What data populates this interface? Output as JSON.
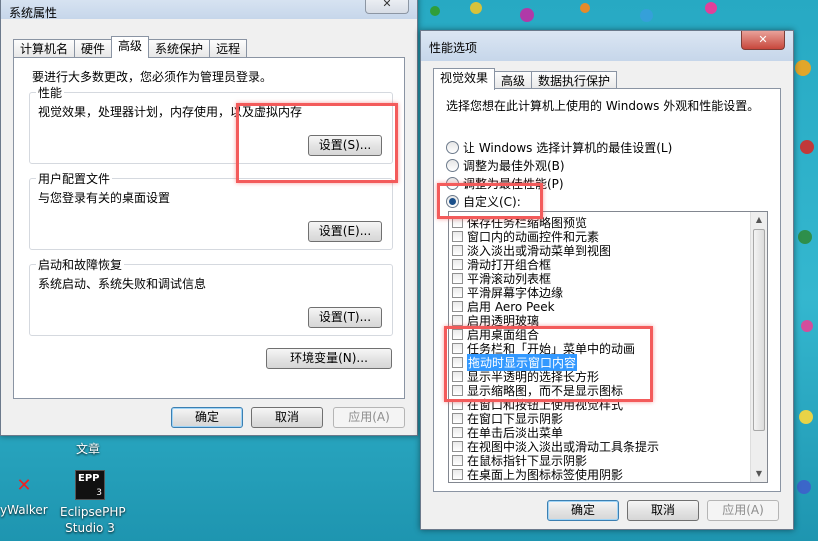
{
  "desktop": {
    "folder_label": "文章",
    "icons": [
      {
        "name": "walker-app-icon",
        "label": "yWalker"
      },
      {
        "name": "eclipsephp-icon",
        "label": "EclipsePHP Studio 3",
        "badge": "EPP",
        "sub": "3"
      }
    ]
  },
  "system_properties": {
    "title": "系统属性",
    "close_glyph": "✕",
    "tabs": [
      "计算机名",
      "硬件",
      "高级",
      "系统保护",
      "远程"
    ],
    "admin_notice": "要进行大多数更改，您必须作为管理员登录。",
    "performance": {
      "label": "性能",
      "desc": "视觉效果，处理器计划，内存使用，以及虚拟内存",
      "button": "设置(S)..."
    },
    "user_profiles": {
      "label": "用户配置文件",
      "desc": "与您登录有关的桌面设置",
      "button": "设置(E)..."
    },
    "startup_recovery": {
      "label": "启动和故障恢复",
      "desc": "系统启动、系统失败和调试信息",
      "button": "设置(T)..."
    },
    "env_button": "环境变量(N)...",
    "ok": "确定",
    "cancel": "取消",
    "apply": "应用(A)"
  },
  "performance_options": {
    "title": "性能选项",
    "close_glyph": "✕",
    "tabs": [
      "视觉效果",
      "高级",
      "数据执行保护"
    ],
    "intro": "选择您想在此计算机上使用的 Windows 外观和性能设置。",
    "radios": [
      {
        "label": "让 Windows 选择计算机的最佳设置(L)",
        "selected": false
      },
      {
        "label": "调整为最佳外观(B)",
        "selected": false
      },
      {
        "label": "调整为最佳性能(P)",
        "selected": false
      },
      {
        "label": "自定义(C):",
        "selected": true
      }
    ],
    "effects": [
      "保存任务栏缩略图预览",
      "窗口内的动画控件和元素",
      "淡入淡出或滑动菜单到视图",
      "滑动打开组合框",
      "平滑滚动列表框",
      "平滑屏幕字体边缘",
      "启用 Aero Peek",
      "启用透明玻璃",
      "启用桌面组合",
      "任务栏和「开始」菜单中的动画",
      "拖动时显示窗口内容",
      "显示半透明的选择长方形",
      "显示缩略图，而不是显示图标",
      "在窗口和按钮上使用视觉样式",
      "在窗口下显示阴影",
      "在单击后淡出菜单",
      "在视图中淡入淡出或滑动工具条提示",
      "在鼠标指针下显示阴影",
      "在桌面上为图标标签使用阴影"
    ],
    "highlighted_index": 10,
    "scroll_up": "▲",
    "scroll_down": "▼",
    "ok": "确定",
    "cancel": "取消",
    "apply": "应用(A)"
  }
}
